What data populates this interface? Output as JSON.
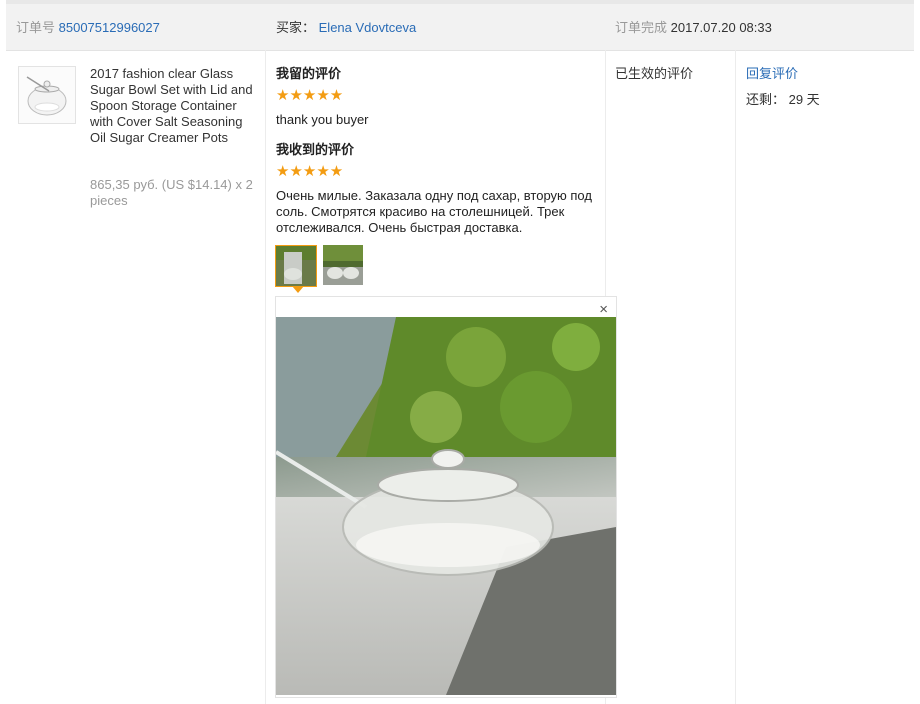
{
  "header": {
    "order_no_label": "订单号",
    "order_no": "85007512996027",
    "buyer_label": "买家：",
    "buyer_name": "Elena Vdovtceva",
    "status_label": "订单完成",
    "status_time": "2017.07.20 08:33"
  },
  "product": {
    "title": "2017 fashion clear Glass Sugar Bowl Set with Lid and Spoon Storage Container with Cover Salt Seasoning Oil Sugar Creamer Pots",
    "price": "865,35 руб. (US $14.14) x 2 pieces"
  },
  "my_review": {
    "heading": "我留的评价",
    "stars": "★★★★★",
    "rating": 5,
    "text": "thank you buyer"
  },
  "received_review": {
    "heading": "我收到的评价",
    "stars": "★★★★★",
    "rating": 5,
    "text": "Очень милые. Заказала одну под сахар, вторую под соль. Смотрятся красиво на столешницей. Трек отслеживался. Очень быстрая доставка."
  },
  "viewer": {
    "close_glyph": "×"
  },
  "effective": {
    "label": "已生效的评价"
  },
  "reply": {
    "link": "回复评价",
    "remaining": "还剩： 29 天"
  },
  "colors": {
    "accent": "#f39c12",
    "link": "#2a6cb6"
  }
}
